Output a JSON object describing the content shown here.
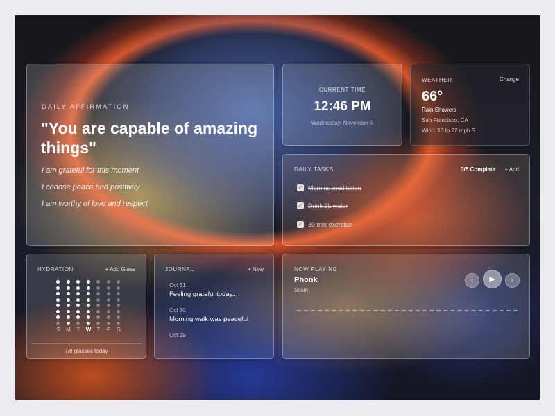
{
  "affirmation": {
    "label": "DAILY AFFIRMATION",
    "quote": "\"You are capable of amazing things\"",
    "lines": [
      "I am grateful for this moment",
      "I choose peace and positivity",
      "I am worthy of love and respect"
    ]
  },
  "time": {
    "label": "CURRENT TIME",
    "clock": "12:46 PM",
    "date": "Wednesday, November 5"
  },
  "weather": {
    "label": "WEATHER",
    "change_label": "Change",
    "temp": "66°",
    "condition": "Rain Showers",
    "location": "San Francisco, CA",
    "wind": "Wind: 13 to 22 mph S"
  },
  "tasks": {
    "label": "DAILY TASKS",
    "progress": "3/5 Complete",
    "add_label": "+ Add",
    "items": [
      {
        "text": "Morning meditation",
        "done": true
      },
      {
        "text": "Drink 2L water",
        "done": true
      },
      {
        "text": "30 min exercise",
        "done": true
      }
    ]
  },
  "hydration": {
    "label": "HYDRATION",
    "add_label": "+ Add Glass",
    "days": [
      "S",
      "M",
      "T",
      "W",
      "T",
      "F",
      "S"
    ],
    "today_index": 3,
    "glasses_per_day": [
      7,
      8,
      7,
      8,
      0,
      0,
      0
    ],
    "max_glasses": 8,
    "footer": "7/8 glasses today"
  },
  "journal": {
    "label": "JOURNAL",
    "new_label": "+ New",
    "entries": [
      {
        "date": "Oct 31",
        "text": "Feeling grateful today..."
      },
      {
        "date": "Oct 30",
        "text": "Morning walk was peaceful"
      },
      {
        "date": "Oct 29",
        "text": ""
      }
    ]
  },
  "now_playing": {
    "label": "NOW PLAYING",
    "song": "Phonk",
    "artist": "Sosin",
    "prev_icon": "‹",
    "play_icon": "▶",
    "next_icon": "›"
  }
}
